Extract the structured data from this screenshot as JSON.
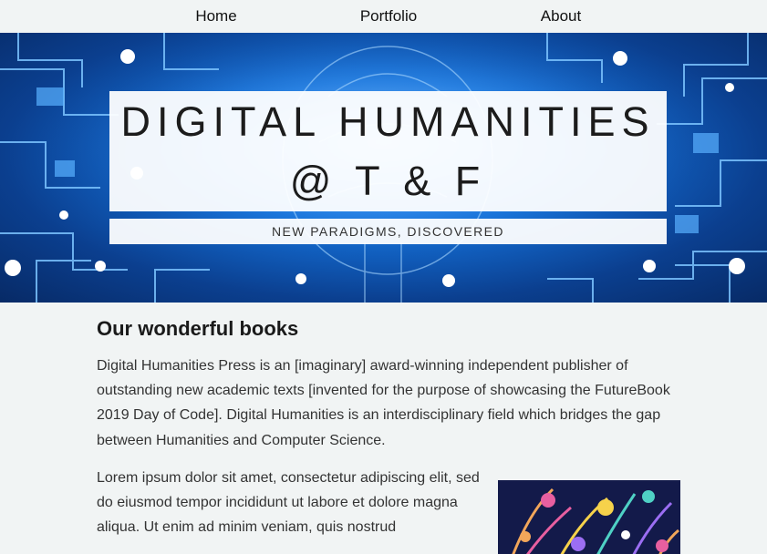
{
  "nav": {
    "items": [
      "Home",
      "Portfolio",
      "About"
    ]
  },
  "hero": {
    "title_line1": "DIGITAL HUMANITIES",
    "title_line2": "@ T & F",
    "subtitle": "NEW PARADIGMS, DISCOVERED"
  },
  "main": {
    "heading": "Our wonderful books",
    "intro": "Digital Humanities Press is an [imaginary] award-winning independent publisher of outstanding new academic texts [invented for the purpose of showcasing the FutureBook 2019 Day of Code]. Digital Humanities is an interdisciplinary field which bridges the gap between Humanities and Computer Science.",
    "lorem": "Lorem ipsum dolor sit amet, consectetur adipiscing elit, sed do eiusmod tempor incididunt ut labore et dolore magna aliqua. Ut enim ad minim veniam, quis nostrud"
  },
  "colors": {
    "hero_blue": "#1470d8",
    "page_bg": "#f1f4f4",
    "cover_bg": "#131a4a"
  }
}
